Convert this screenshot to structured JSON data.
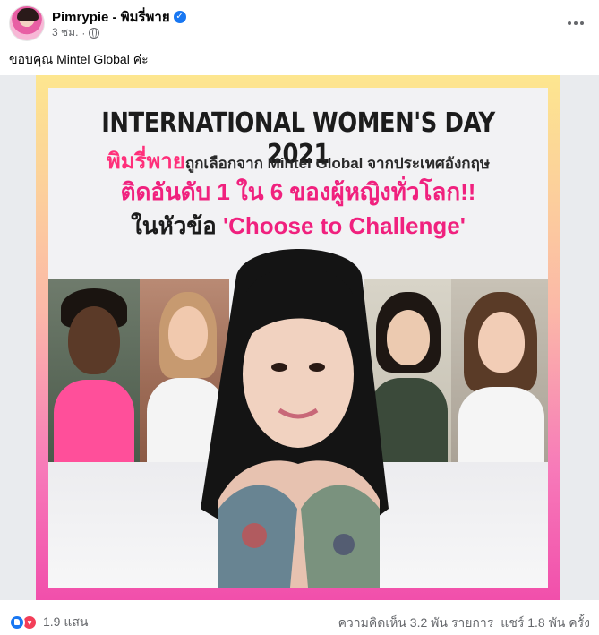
{
  "post": {
    "page_name": "Pimrypie - พิมรี่พาย",
    "time": "3 ชม.",
    "separator": "·",
    "caption": "ขอบคุณ Mintel Global ค่ะ"
  },
  "poster": {
    "title": "INTERNATIONAL WOMEN'S DAY 2021",
    "line1_highlight": "พิมรี่พาย",
    "line1_rest": "ถูกเลือกจาก Mintel Global จากประเทศอังกฤษ",
    "line2": "ติดอันดับ 1 ใน 6 ของผู้หญิงทั่วโลก!!",
    "line3_prefix": "ในหัวข้อ ",
    "line3_highlight": "'Choose to Challenge'"
  },
  "footer": {
    "reaction_count": "1.9 แสน",
    "comments": "ความคิดเห็น 3.2 พัน รายการ",
    "shares": "แชร์ 1.8 พัน ครั้ง"
  },
  "icons": {
    "verified": "verified-badge-icon",
    "audience": "globe-icon",
    "more": "more-options-icon",
    "like": "like-reaction-icon",
    "love": "love-reaction-icon"
  },
  "colors": {
    "brand_blue": "#1877f2",
    "poster_pink": "#f0217e",
    "love_red": "#f33e58"
  }
}
